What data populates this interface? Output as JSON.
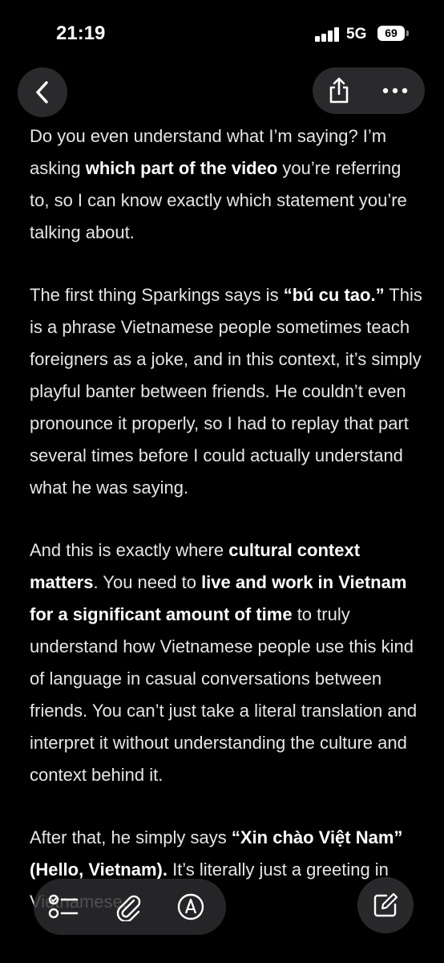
{
  "status_bar": {
    "time": "21:19",
    "network": "5G",
    "battery": "69"
  },
  "nav": {
    "back_icon": "chevron-left-icon",
    "share_icon": "share-icon",
    "more_icon": "ellipsis-icon"
  },
  "content": {
    "p1": [
      {
        "text": "Do you even understand what I’m saying? I’m asking ",
        "bold": false
      },
      {
        "text": "which part of the video",
        "bold": true
      },
      {
        "text": " you’re referring to, so I can know exactly which statement you’re talking about.",
        "bold": false
      }
    ],
    "p2": [
      {
        "text": "The first thing Sparkings says is ",
        "bold": false
      },
      {
        "text": "“bú cu tao.”",
        "bold": true
      },
      {
        "text": " This is a phrase Vietnamese people sometimes teach foreigners as a joke, and in this context, it’s simply playful banter between friends. He couldn’t even pronounce it properly, so I had to replay that part several times before I could actually understand what he was saying.",
        "bold": false
      }
    ],
    "p3": [
      {
        "text": "And this is exactly where ",
        "bold": false
      },
      {
        "text": "cultural context matters",
        "bold": true
      },
      {
        "text": ". You need to ",
        "bold": false
      },
      {
        "text": "live and work in Vietnam for a significant amount of time",
        "bold": true
      },
      {
        "text": " to truly understand how Vietnamese people use this kind of language in casual conversations between friends. You can’t just take a literal translation and interpret it without understanding the culture and context behind it.",
        "bold": false
      }
    ],
    "p4": [
      {
        "text": "After that, he simply says ",
        "bold": false
      },
      {
        "text": "“Xin chào Việt Nam” (Hello, Vietnam).",
        "bold": true
      },
      {
        "text": " It’s literally just a greeting in Vietnamese.",
        "bold": false
      }
    ]
  },
  "toolbar": {
    "checklist_icon": "checklist-icon",
    "attach_icon": "paperclip-icon",
    "markup_icon": "pen-circle-icon",
    "compose_icon": "compose-icon"
  },
  "colors": {
    "background": "#000000",
    "text": "#e6e6e6",
    "button_bg": "#2a2a2c"
  }
}
